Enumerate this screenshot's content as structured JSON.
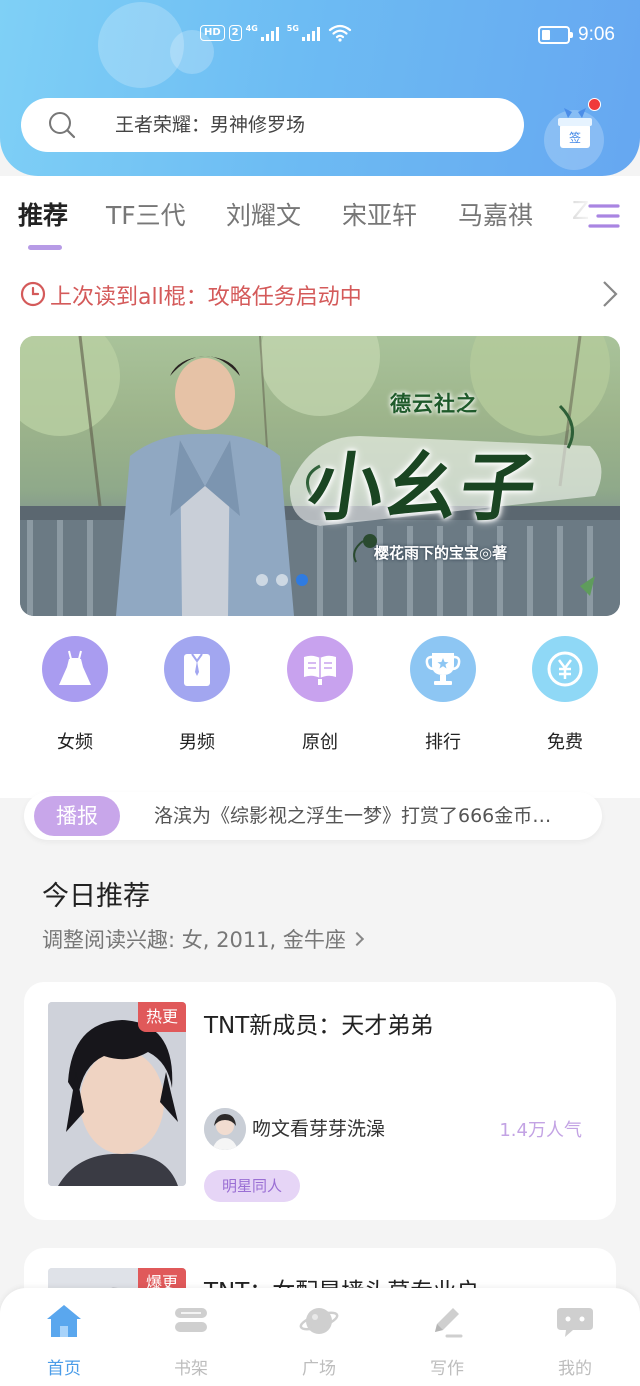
{
  "status_bar": {
    "hd": "HD",
    "sim": "2",
    "net1": "4G",
    "net2": "5G",
    "time": "9:06"
  },
  "search": {
    "placeholder": "王者荣耀：男神修罗场"
  },
  "checkin": {
    "label": "签"
  },
  "tabs": [
    {
      "label": "推荐",
      "active": true
    },
    {
      "label": "TF三代"
    },
    {
      "label": "刘耀文"
    },
    {
      "label": "宋亚轩"
    },
    {
      "label": "马嘉祺"
    },
    {
      "label": "Z"
    }
  ],
  "continue_reading": {
    "prefix": "上次读到",
    "title": "all棍：攻略任务启动中"
  },
  "banner": {
    "subtitle": "德云社之",
    "title": "小幺子",
    "author": "樱花雨下的宝宝◎著",
    "slide_count": 3,
    "active_slide": 3
  },
  "categories": [
    {
      "label": "女频",
      "icon": "dress-icon",
      "color": "#a99cf0"
    },
    {
      "label": "男频",
      "icon": "shirt-icon",
      "color": "#a2a6f0"
    },
    {
      "label": "原创",
      "icon": "book-icon",
      "color": "#c8a2ee"
    },
    {
      "label": "排行",
      "icon": "trophy-icon",
      "color": "#8dc6f3"
    },
    {
      "label": "免费",
      "icon": "yuan-coin-icon",
      "color": "#8fd8f6"
    }
  ],
  "announcement": {
    "badge": "播报",
    "text": "洛滨为《综影视之浮生一梦》打赏了666金币…"
  },
  "today": {
    "title": "今日推荐",
    "subtitle": "调整阅读兴趣: 女, 2011, 金牛座"
  },
  "books": [
    {
      "badge": "热更",
      "title": "TNT新成员：天才弟弟",
      "author": "吻文看芽芽洗澡",
      "popularity": "1.4万人气",
      "tag": "明星同人"
    },
    {
      "badge": "爆更",
      "title": "TNT：女配是墙头草专业户"
    }
  ],
  "bottom_nav": [
    {
      "label": "首页",
      "icon": "home-icon",
      "active": true
    },
    {
      "label": "书架",
      "icon": "bookshelf-icon"
    },
    {
      "label": "广场",
      "icon": "planet-icon"
    },
    {
      "label": "写作",
      "icon": "pen-icon"
    },
    {
      "label": "我的",
      "icon": "chat-icon"
    }
  ],
  "colors": {
    "accent": "#b79be6",
    "header_start": "#7fd0f6",
    "header_end": "#66a7f1",
    "nav_active": "#4a9ce8",
    "continue_text": "#d45a5a"
  }
}
